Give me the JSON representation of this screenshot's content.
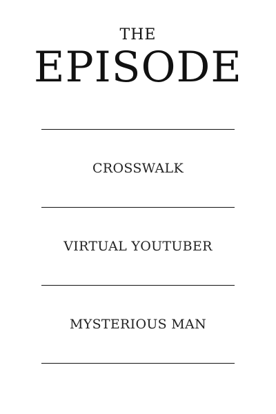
{
  "header": {
    "pre_title": "THE",
    "title": "EPISODE"
  },
  "episodes": [
    {
      "label": "CROSSWALK"
    },
    {
      "label": "VIRTUAL YOUTUBER"
    },
    {
      "label": "MYSTERIOUS MAN"
    }
  ],
  "colors": {
    "background": "#ffffff",
    "text": "#111111",
    "rule": "#111111"
  }
}
